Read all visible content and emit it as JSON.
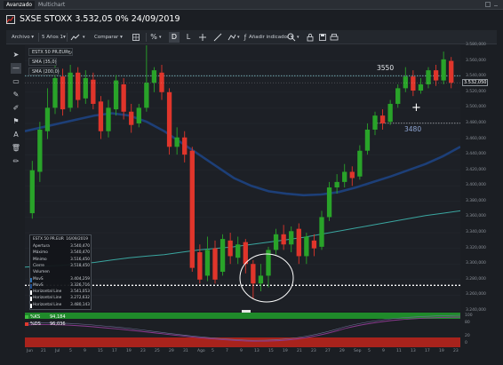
{
  "tabs": [
    {
      "label": "Avanzado",
      "active": true
    },
    {
      "label": "Multichart",
      "active": false
    }
  ],
  "title": "SXSE STOXX 3.532,05 0% 24/09/2019",
  "toolbar": {
    "archivo": "Archivo ▾",
    "period": "5 Años 1▾",
    "compare": "Comparar ▾",
    "percent": "%",
    "d": "D",
    "l": "L",
    "indicator": "Añadir indicador ▾",
    "buttons": [
      "chart-type-icon",
      "grid-icon",
      "d-tool",
      "l-tool",
      "crosshair-icon",
      "drawing-icon",
      "draw-tools-icon",
      "zoom-icon",
      "lock-icon",
      "save-icon",
      "print-icon"
    ]
  },
  "legend": {
    "instrument": "ESTX 50 PR.EUR",
    "sma1": "SMA (35,0)",
    "sma2": "SMA (200,0)"
  },
  "data_panel": {
    "name": "ESTX 50 PR.EUR",
    "date": "16/09/2019",
    "rows": [
      {
        "label": "Apertura",
        "value": "3.540,470",
        "swatch": ""
      },
      {
        "label": "Máximo",
        "value": "3.540,470",
        "swatch": ""
      },
      {
        "label": "Mínimo",
        "value": "3.516,450",
        "swatch": ""
      },
      {
        "label": "Cierre",
        "value": "3.518,450",
        "swatch": ""
      },
      {
        "label": "Volumen",
        "value": "",
        "swatch": ""
      },
      {
        "label": "MovS",
        "value": "3.404,259",
        "swatch": "#2e6fb0"
      },
      {
        "label": "MovS",
        "value": "3.326,716",
        "swatch": "#1e4b8a"
      },
      {
        "label": "Horizontal Line",
        "value": "3.541,053",
        "swatch": "#ffffff"
      },
      {
        "label": "Horizontal Line",
        "value": "3.272,632",
        "swatch": "#ffffff"
      },
      {
        "label": "Horizontal Line",
        "value": "3.480,143",
        "swatch": "#ffffff"
      }
    ]
  },
  "annotations": {
    "level_high": "3550",
    "level_mid": "3480"
  },
  "price_axis": [
    "3.580,000",
    "3.560,000",
    "3.540,000",
    "3.520,000",
    "3.500,000",
    "3.480,000",
    "3.460,000",
    "3.440,000",
    "3.420,000",
    "3.400,000",
    "3.380,000",
    "3.360,000",
    "3.340,000",
    "3.320,000",
    "3.300,000",
    "3.280,000",
    "3.260,000",
    "3.240,000"
  ],
  "price_label": "3.532,050",
  "oscillator": {
    "rows": [
      {
        "name": "%KS",
        "value": "94,184",
        "color": "#3fbf3f"
      },
      {
        "name": "%DS",
        "value": "96,036",
        "color": "#e03a2f"
      }
    ],
    "axis": [
      "100",
      "80",
      "20",
      "0"
    ]
  },
  "time_axis": [
    "Jun",
    "21",
    "Jul",
    "5",
    "9",
    "15",
    "17",
    "19",
    "23",
    "25",
    "29",
    "31",
    "Ago",
    "5",
    "7",
    "9",
    "13",
    "15",
    "19",
    "21",
    "23",
    "27",
    "29",
    "Sep",
    "5",
    "9",
    "11",
    "13",
    "17",
    "19",
    "23"
  ],
  "chart_data": {
    "type": "candlestick",
    "ylim": [
      3240,
      3580
    ],
    "candles": [
      {
        "o": 3365,
        "c": 3420,
        "h": 3432,
        "l": 3358
      },
      {
        "o": 3418,
        "c": 3472,
        "h": 3482,
        "l": 3405
      },
      {
        "o": 3470,
        "c": 3500,
        "h": 3525,
        "l": 3460
      },
      {
        "o": 3500,
        "c": 3538,
        "h": 3555,
        "l": 3492
      },
      {
        "o": 3540,
        "c": 3498,
        "h": 3550,
        "l": 3490
      },
      {
        "o": 3500,
        "c": 3545,
        "h": 3555,
        "l": 3495
      },
      {
        "o": 3545,
        "c": 3510,
        "h": 3552,
        "l": 3500
      },
      {
        "o": 3512,
        "c": 3538,
        "h": 3548,
        "l": 3505
      },
      {
        "o": 3536,
        "c": 3505,
        "h": 3545,
        "l": 3498
      },
      {
        "o": 3508,
        "c": 3470,
        "h": 3515,
        "l": 3460
      },
      {
        "o": 3470,
        "c": 3500,
        "h": 3510,
        "l": 3462
      },
      {
        "o": 3498,
        "c": 3535,
        "h": 3542,
        "l": 3490
      },
      {
        "o": 3530,
        "c": 3495,
        "h": 3538,
        "l": 3485
      },
      {
        "o": 3495,
        "c": 3478,
        "h": 3505,
        "l": 3468
      },
      {
        "o": 3480,
        "c": 3500,
        "h": 3505,
        "l": 3475
      },
      {
        "o": 3500,
        "c": 3532,
        "h": 3585,
        "l": 3495
      },
      {
        "o": 3532,
        "c": 3548,
        "h": 3552,
        "l": 3520
      },
      {
        "o": 3545,
        "c": 3520,
        "h": 3555,
        "l": 3510
      },
      {
        "o": 3520,
        "c": 3450,
        "h": 3525,
        "l": 3440
      },
      {
        "o": 3450,
        "c": 3462,
        "h": 3475,
        "l": 3440
      },
      {
        "o": 3462,
        "c": 3440,
        "h": 3470,
        "l": 3430
      },
      {
        "o": 3445,
        "c": 3295,
        "h": 3450,
        "l": 3290
      },
      {
        "o": 3315,
        "c": 3280,
        "h": 3325,
        "l": 3275
      },
      {
        "o": 3285,
        "c": 3318,
        "h": 3335,
        "l": 3278
      },
      {
        "o": 3320,
        "c": 3280,
        "h": 3330,
        "l": 3275
      },
      {
        "o": 3290,
        "c": 3332,
        "h": 3338,
        "l": 3285
      },
      {
        "o": 3330,
        "c": 3310,
        "h": 3340,
        "l": 3300
      },
      {
        "o": 3308,
        "c": 3325,
        "h": 3335,
        "l": 3300
      },
      {
        "o": 3328,
        "c": 3300,
        "h": 3332,
        "l": 3288
      },
      {
        "o": 3300,
        "c": 3275,
        "h": 3305,
        "l": 3255
      },
      {
        "o": 3275,
        "c": 3285,
        "h": 3300,
        "l": 3265
      },
      {
        "o": 3285,
        "c": 3318,
        "h": 3322,
        "l": 3270
      },
      {
        "o": 3318,
        "c": 3338,
        "h": 3345,
        "l": 3312
      },
      {
        "o": 3338,
        "c": 3325,
        "h": 3350,
        "l": 3318
      },
      {
        "o": 3325,
        "c": 3342,
        "h": 3348,
        "l": 3315
      },
      {
        "o": 3345,
        "c": 3310,
        "h": 3352,
        "l": 3300
      },
      {
        "o": 3310,
        "c": 3335,
        "h": 3340,
        "l": 3300
      },
      {
        "o": 3330,
        "c": 3320,
        "h": 3338,
        "l": 3310
      },
      {
        "o": 3322,
        "c": 3360,
        "h": 3368,
        "l": 3318
      },
      {
        "o": 3360,
        "c": 3398,
        "h": 3405,
        "l": 3355
      },
      {
        "o": 3398,
        "c": 3405,
        "h": 3415,
        "l": 3390
      },
      {
        "o": 3405,
        "c": 3418,
        "h": 3428,
        "l": 3398
      },
      {
        "o": 3418,
        "c": 3410,
        "h": 3425,
        "l": 3400
      },
      {
        "o": 3412,
        "c": 3445,
        "h": 3452,
        "l": 3408
      },
      {
        "o": 3445,
        "c": 3472,
        "h": 3480,
        "l": 3440
      },
      {
        "o": 3472,
        "c": 3490,
        "h": 3495,
        "l": 3465
      },
      {
        "o": 3490,
        "c": 3480,
        "h": 3498,
        "l": 3472
      },
      {
        "o": 3482,
        "c": 3505,
        "h": 3510,
        "l": 3478
      },
      {
        "o": 3505,
        "c": 3525,
        "h": 3530,
        "l": 3500
      },
      {
        "o": 3525,
        "c": 3540,
        "h": 3552,
        "l": 3520
      },
      {
        "o": 3540,
        "c": 3522,
        "h": 3548,
        "l": 3515
      },
      {
        "o": 3522,
        "c": 3530,
        "h": 3538,
        "l": 3518
      },
      {
        "o": 3530,
        "c": 3548,
        "h": 3552,
        "l": 3525
      },
      {
        "o": 3548,
        "c": 3535,
        "h": 3555,
        "l": 3528
      },
      {
        "o": 3535,
        "c": 3562,
        "h": 3572,
        "l": 3530
      },
      {
        "o": 3560,
        "c": 3532,
        "h": 3565,
        "l": 3525
      }
    ],
    "sma_35": [
      3470,
      3475,
      3480,
      3485,
      3490,
      3493,
      3490,
      3482,
      3470,
      3455,
      3440,
      3425,
      3410,
      3400,
      3393,
      3390,
      3388,
      3389,
      3392,
      3398,
      3405,
      3412,
      3420,
      3428,
      3438,
      3450
    ],
    "sma_200": [
      3296,
      3297,
      3298,
      3300,
      3302,
      3305,
      3308,
      3310,
      3312,
      3315,
      3318,
      3320,
      3322,
      3325,
      3328,
      3331,
      3334,
      3338,
      3342,
      3346,
      3350,
      3354,
      3358,
      3362,
      3365,
      3368
    ],
    "horizontal_lines": [
      3541.053,
      3272.632,
      3480.143
    ],
    "price_line": 3532.05,
    "stochastic": {
      "k": 94.184,
      "d": 96.036
    }
  },
  "colors": {
    "up": "#29a329",
    "down": "#e0352b",
    "sma35": "#1d3f78",
    "sma200": "#3aa6a0",
    "background": "#1d2026"
  }
}
